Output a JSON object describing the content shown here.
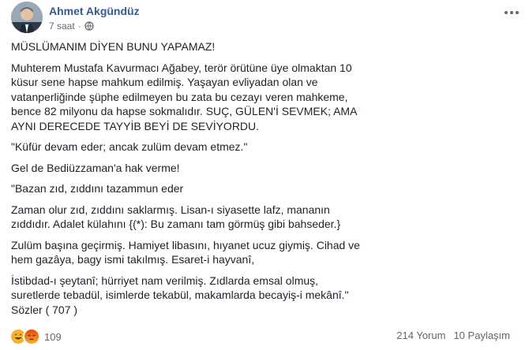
{
  "post": {
    "author": "Ahmet Akgündüz",
    "time": "7 saat",
    "separator": "·",
    "paragraphs": [
      "MÜSLÜMANIM DİYEN BUNU YAPAMAZ!",
      "Muhterem Mustafa Kavurmacı Ağabey, terör örütüne üye olmaktan 10\nküsur sene hapse mahkum edilmiş. Yaşayan evliyadan olan ve\nvatanperliğinde şüphe edilmeyen bu zata bu cezayı veren mahkeme,\nbence 82 milyonu da hapse sokmalıdır. SUÇ, GÜLEN'İ SEVMEK; AMA\nAYNI DERECEDE TAYYİB BEYİ DE SEVİYORDU.",
      "\"Küfür devam eder; ancak zulüm devam etmez.\"",
      "Gel de Bediüzzaman'a hak verme!",
      "\"Bazan zıd, zıddını tazammun eder",
      "Zaman olur zıd, zıddını saklarmış. Lisan-ı siyasette lafz, mananın\nzıddıdır. Adalet külahını {(*): Bu zamanı tam görmüş gibi bahseder.}",
      "Zulüm başına geçirmiş. Hamiyet libasını, hıyanet ucuz giymiş. Cihad ve\nhem gazâya, bagy ismi takılmış. Esaret-i hayvanî,",
      "İstibdad-ı şeytanî; hürriyet nam verilmiş. Zıdlarda emsal olmuş,\nsuretlerde tebadül, isimlerde tekabül, makamlarda becayiş-i mekânî.\"\nSözler ( 707 )"
    ]
  },
  "footer": {
    "reaction_count": "109",
    "comments": "214 Yorum",
    "shares": "10 Paylaşım",
    "reaction_icons": [
      "haha-icon",
      "angry-icon"
    ],
    "colors": {
      "link": "#385898",
      "angry": "#e9710f",
      "haha": "#f7b125"
    }
  }
}
